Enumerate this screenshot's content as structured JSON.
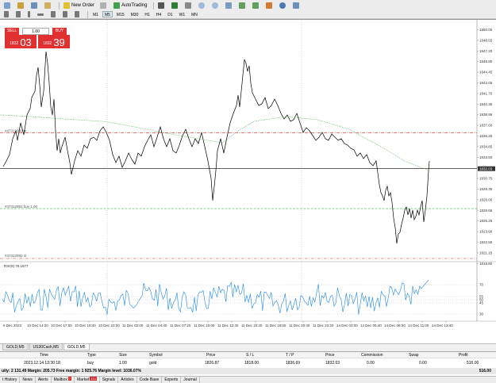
{
  "toolbar": {
    "new_order": "New Order",
    "autotrading": "AutoTrading",
    "timeframes": [
      "M1",
      "M5",
      "M15",
      "M30",
      "H1",
      "H4",
      "D1",
      "W1",
      "MN"
    ],
    "active_timeframe": "M5"
  },
  "trade_panel": {
    "sell_label": "SELL",
    "buy_label": "BUY",
    "volume": "1.00",
    "sell_price_small": "1832",
    "sell_price_big": "03",
    "buy_price_small": "1832",
    "buy_price_big": "39"
  },
  "chart": {
    "symbol_label": "GOLD,M5",
    "indicator_label": "RSI(9) 75.1877",
    "price_axis": [
      "1850.00",
      "1848.55",
      "1847.20",
      "1845.80",
      "1844.45",
      "1843.05",
      "1841.70",
      "1840.35",
      "1838.95",
      "1837.60",
      "1836.25",
      "1834.85",
      "1833.50",
      "1832.05",
      "1830.75",
      "1829.35",
      "1828.00",
      "1826.65",
      "1825.25",
      "1823.90",
      "1822.55",
      "1821.15",
      "1819.80"
    ],
    "current_price": "1832.03",
    "line_labels": {
      "top_line": "#47312992 tp",
      "entry_line": "#47312992 buy 1.00",
      "sl_line": "#47312992 sl"
    },
    "rsi_axis": [
      "70",
      "55",
      "50",
      "45",
      "30"
    ],
    "time_axis": [
      "6 Dec 2023",
      "10 Dec 14:20",
      "10 Dec 17:00",
      "10 Dec 19:40",
      "10 Dec 22:20",
      "11 Dec 02:00",
      "11 Dec 04:40",
      "11 Dec 07:20",
      "11 Dec 10:00",
      "11 Dec 12:40",
      "11 Dec 15:20",
      "11 Dec 18:00",
      "11 Dec 20:40",
      "11 Dec 23:20",
      "14 Dec 03:00",
      "14 Dec 05:40",
      "14 Dec 08:20",
      "14 Dec 11:00",
      "14 Dec 13:40"
    ],
    "colors": {
      "price_line": "#000000",
      "ma_line": "#4caf50",
      "tp_line": "#c62828",
      "entry_line": "#4caf50",
      "rsi_line": "#1e88e5",
      "sell_buy": "#e03030"
    }
  },
  "chart_tabs": [
    "GOLD,M5",
    "US30Cash,M5",
    "GOLD,M5"
  ],
  "active_chart_tab": 2,
  "terminal": {
    "headers": [
      "Time",
      "Type",
      "Size",
      "Symbol",
      "Price",
      "S / L",
      "T / P",
      "Price",
      "Commission",
      "Swap",
      "Profit"
    ],
    "row": [
      "2023.12.14 13:30:18",
      "buy",
      "1.00",
      "gold",
      "1826.87",
      "1818.00",
      "1836.69",
      "1832.03",
      "0.00",
      "0.00",
      "516.00"
    ],
    "summary_text": "uity: 2 131.49  Margin: 205.73  Free margin: 1 925.76  Margin level: 1036.07%",
    "summary_profit": "516.00"
  },
  "bottom_tabs": [
    {
      "label": "t History",
      "badge": ""
    },
    {
      "label": "News",
      "badge": ""
    },
    {
      "label": "Alerts",
      "badge": ""
    },
    {
      "label": "Mailbox",
      "badge": "7"
    },
    {
      "label": "Market",
      "badge": "114"
    },
    {
      "label": "Signals",
      "badge": ""
    },
    {
      "label": "Articles",
      "badge": ""
    },
    {
      "label": "Code Base",
      "badge": ""
    },
    {
      "label": "Experts",
      "badge": ""
    },
    {
      "label": "Journal",
      "badge": ""
    }
  ]
}
